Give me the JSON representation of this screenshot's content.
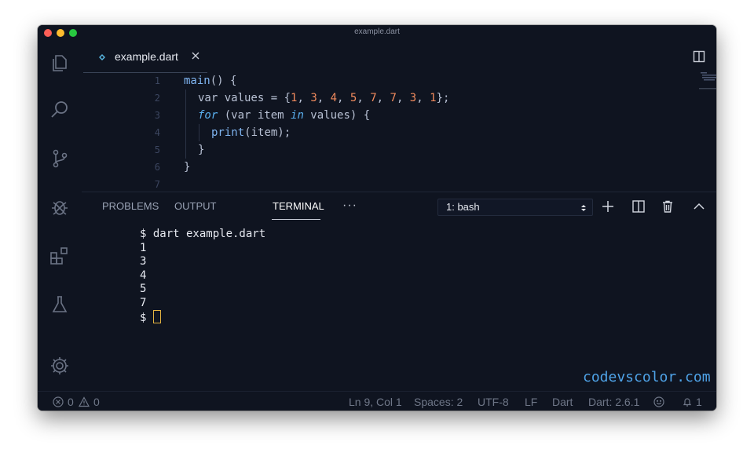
{
  "window": {
    "title": "example.dart"
  },
  "activity_bar": [
    "explorer-icon",
    "search-icon",
    "source-control-icon",
    "debug-icon",
    "extensions-icon",
    "flask-icon",
    "settings-gear-icon"
  ],
  "tab": {
    "filename": "example.dart",
    "icon": "dart-file-icon"
  },
  "editor": {
    "lines": [
      {
        "n": "1"
      },
      {
        "n": "2"
      },
      {
        "n": "3"
      },
      {
        "n": "4"
      },
      {
        "n": "5"
      },
      {
        "n": "6"
      },
      {
        "n": "7"
      }
    ],
    "tokens": {
      "main": "main",
      "main_rest": "() {",
      "var1": "var values = {",
      "nums": [
        "1",
        "3",
        "4",
        "5",
        "7",
        "7",
        "3",
        "1"
      ],
      "sep": ", ",
      "end2": "};",
      "for_kw": "for",
      "for_mid1": " (var item ",
      "in_kw": "in",
      "for_mid2": " values) {",
      "print_fn": "print",
      "print_rest": "(item);",
      "close_inner": "}",
      "close_outer": "}"
    }
  },
  "panel": {
    "tabs": [
      "PROBLEMS",
      "OUTPUT",
      "TERMINAL"
    ],
    "active_tab": "TERMINAL",
    "more": "···",
    "terminal_select": "1: bash",
    "terminal_lines": [
      "$ dart example.dart",
      "1",
      "3",
      "4",
      "5",
      "7"
    ],
    "prompt": "$ "
  },
  "watermark": "codevscolor.com",
  "status": {
    "errors": "0",
    "warnings": "0",
    "position": "Ln 9, Col 1",
    "spaces": "Spaces: 2",
    "encoding": "UTF-8",
    "eol": "LF",
    "language": "Dart",
    "sdk": "Dart: 2.6.1",
    "notifications": "1"
  },
  "colors": {
    "background": "#0f1420",
    "keyword": "#5ab0f0",
    "number": "#f08a5d",
    "text": "#b8c1d4",
    "cursor": "#e3b341",
    "watermark": "#4fa3e8"
  }
}
